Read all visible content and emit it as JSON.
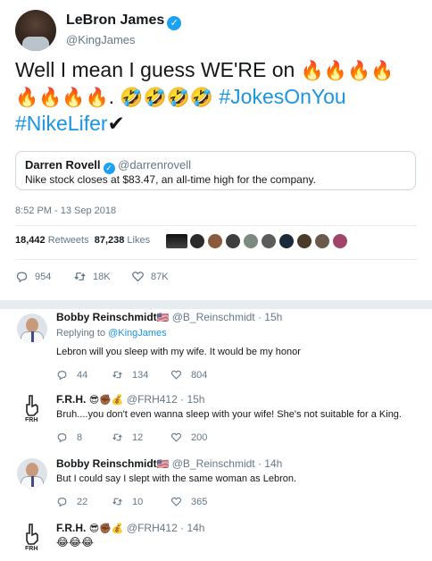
{
  "tweet": {
    "author_name": "LeBron James",
    "author_handle": "@KingJames",
    "text_prefix": "Well I mean I guess WE'RE on ",
    "fire_line1": "🔥🔥🔥🔥",
    "fire_line2": "🔥🔥🔥🔥",
    "laugh": "🤣🤣🤣🤣",
    "hashtag1": "#JokesOnYou",
    "hashtag2": "#NikeLifer",
    "check": "✔",
    "quote": {
      "author_name": "Darren Rovell",
      "author_handle": "@darrenrovell",
      "text": "Nike stock closes at $83.47, an all-time high for the company."
    },
    "timestamp": "8:52 PM - 13 Sep 2018",
    "retweets_count": "18,442",
    "retweets_label": "Retweets",
    "likes_count": "87,238",
    "likes_label": "Likes",
    "actions": {
      "replies": "954",
      "retweets": "18K",
      "likes": "87K"
    }
  },
  "replies": [
    {
      "author_name": "Bobby Reinschmidt",
      "flag": "🇺🇸",
      "handle": "@B_Reinschmidt",
      "time": "15h",
      "replying_prefix": "Replying to ",
      "replying_to": "@KingJames",
      "text": "Lebron will you sleep with my wife. It would be my honor",
      "replies": "44",
      "retweets": "134",
      "likes": "804"
    },
    {
      "author_name": "F.R.H.",
      "badges": "😎✊🏾💰",
      "handle": "@FRH412",
      "time": "15h",
      "text": "Bruh....you don't even wanna sleep with your wife! She's not suitable for a King.",
      "replies": "8",
      "retweets": "12",
      "likes": "200"
    },
    {
      "author_name": "Bobby Reinschmidt",
      "flag": "🇺🇸",
      "handle": "@B_Reinschmidt",
      "time": "14h",
      "text": "But I could say I slept with the same woman as Lebron.",
      "replies": "22",
      "retweets": "10",
      "likes": "365"
    },
    {
      "author_name": "F.R.H.",
      "badges": "😎✊🏾💰",
      "handle": "@FRH412",
      "time": "14h",
      "text": "😂😂😂"
    }
  ],
  "icons": {
    "reply": "reply-icon",
    "retweet": "retweet-icon",
    "like": "heart-icon",
    "verified": "verified-badge-icon"
  },
  "colors": {
    "link": "#1b95e0",
    "muted": "#657786",
    "verified": "#1da1f2",
    "border": "#e6ecf0"
  }
}
